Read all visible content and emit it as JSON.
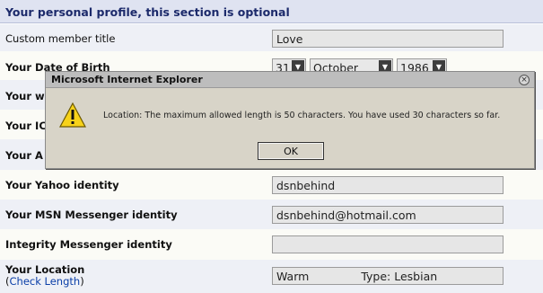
{
  "section": {
    "title": "Your personal profile, this section is optional"
  },
  "rows": {
    "custom_title": {
      "label": "Custom member title",
      "value": "Love"
    },
    "dob": {
      "label": "Your Date of Birth",
      "day": "31",
      "month": "October",
      "year": "1986"
    },
    "website": {
      "label": "Your w"
    },
    "icq": {
      "label": "Your IC"
    },
    "aim": {
      "label": "Your A"
    },
    "yahoo": {
      "label": "Your Yahoo identity",
      "value": "dsnbehind"
    },
    "msn": {
      "label": "Your MSN Messenger identity",
      "value": "dsnbehind@hotmail.com"
    },
    "integrity": {
      "label": "Integrity Messenger identity",
      "value": ""
    },
    "location": {
      "label": "Your Location",
      "sub_open": "(",
      "sub_link": "Check Length",
      "sub_close": ")",
      "value_part1": "Warm",
      "value_part2": "Type: Lesbian"
    }
  },
  "dialog": {
    "title": "Microsoft Internet Explorer",
    "message": "Location: The maximum allowed length is 50 characters.  You have used 30 characters so far.",
    "ok_label": "OK",
    "icon": "warning-icon",
    "close_icon": "close-icon"
  },
  "colors": {
    "header_bg": "#dfe3f1",
    "header_text": "#1c2a6b",
    "link": "#0b3fa8",
    "dialog_bg": "#d8d4c8"
  }
}
